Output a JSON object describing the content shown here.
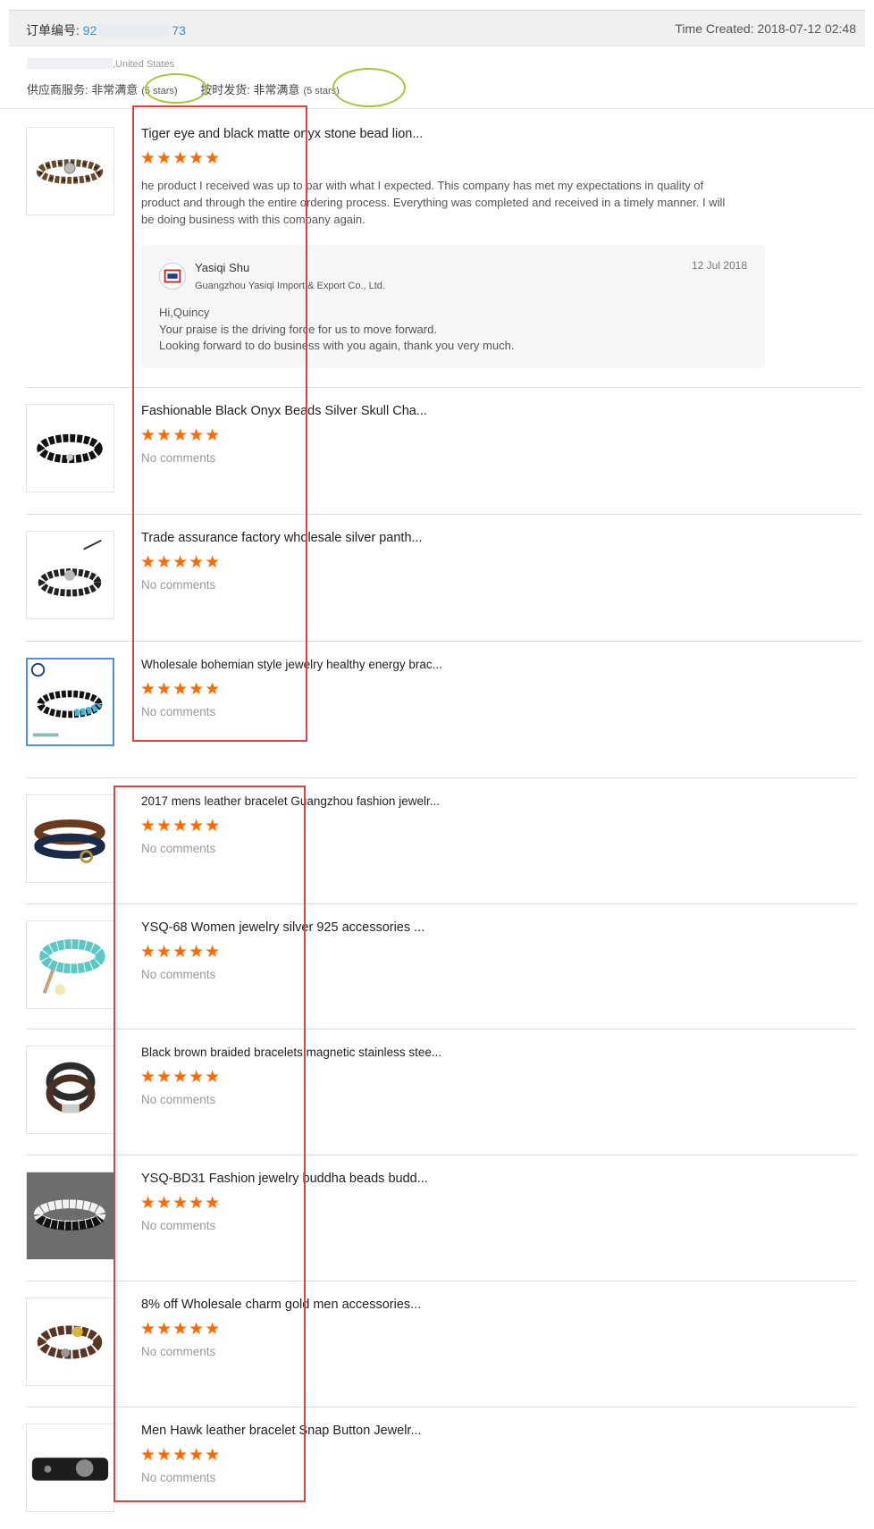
{
  "header": {
    "order_label": "订单编号: ",
    "order_prefix": "92",
    "order_suffix": "73",
    "time_created": "Time Created: 2018-07-12 02:48"
  },
  "buyer": {
    "country": ",United States"
  },
  "ratings": {
    "supplier_service": {
      "label": "供应商服务: 非常满意",
      "stars": "(5 stars)"
    },
    "on_time": {
      "label": "按时发货: 非常满意",
      "stars": "(5 stars)"
    }
  },
  "stars_glyph": "★★★★★",
  "items": [
    {
      "title": "Tiger eye and black matte onyx stone bead lion...",
      "review": "he product I received was up to par with what I expected. This company has met my expectations in quality of product and through the entire ordering process. Everything was completed and received in a timely manner. I will be doing business with this company again.",
      "reply": {
        "name": "Yasiqi Shu",
        "company": "Guangzhou Yasiqi Import & Export Co., Ltd.",
        "date": "12 Jul 2018",
        "line1": "Hi,Quincy",
        "line2": "Your praise is the driving force for us to move forward.",
        "line3": "Looking forward to do business with you again, thank you very much."
      }
    },
    {
      "title": "Fashionable Black Onyx Beads Silver Skull Cha...",
      "comment": "No comments"
    },
    {
      "title": "Trade assurance factory wholesale silver panth...",
      "comment": "No comments"
    },
    {
      "title": "Wholesale bohemian style jewelry healthy energy brac...",
      "comment": "No comments"
    },
    {
      "title": "2017 mens leather bracelet Guangzhou fashion jewelr...",
      "comment": "No comments"
    },
    {
      "title": "YSQ-68 Women jewelry silver 925 accessories ...",
      "comment": "No comments"
    },
    {
      "title": "Black brown braided bracelets magnetic stainless stee...",
      "comment": "No comments"
    },
    {
      "title": "YSQ-BD31 Fashion jewelry buddha beads budd...",
      "comment": "No comments"
    },
    {
      "title": "8% off Wholesale charm gold men accessories...",
      "comment": "No comments"
    },
    {
      "title": "Men Hawk leather bracelet Snap Button Jewelr...",
      "comment": "No comments"
    }
  ],
  "colors": {
    "star": "#ff6a00",
    "annotation_box": "#e0403e",
    "annotation_oval": "#a4c639",
    "link": "#3d8fd8"
  }
}
